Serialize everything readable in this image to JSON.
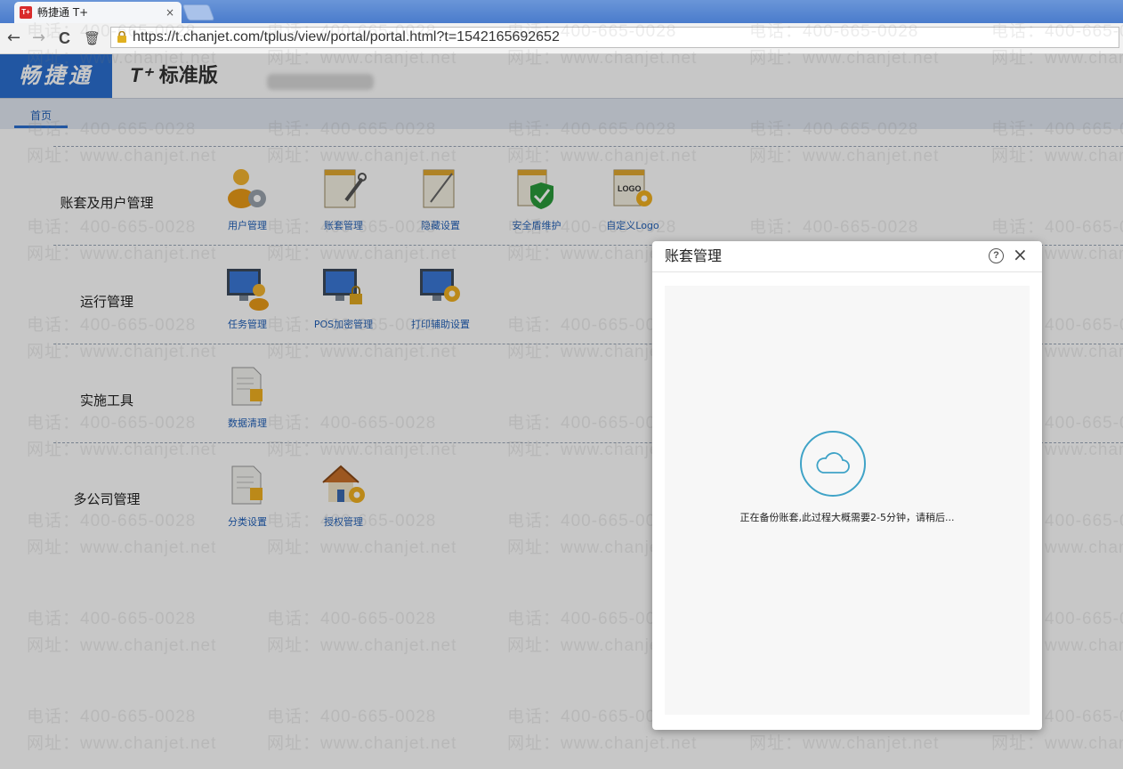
{
  "browser": {
    "tab_title": "畅捷通 T+",
    "tab_close": "×",
    "favicon_text": "T+",
    "back": "←",
    "forward": "→",
    "reload": "C",
    "delete": "🗑",
    "url": "https://t.chanjet.com/tplus/view/portal/portal.html?t=1542165692652"
  },
  "header": {
    "brand": "畅捷通",
    "product_t": "T⁺",
    "product_name": "标准版"
  },
  "nav": {
    "home": "首页"
  },
  "groups": [
    {
      "title": "账套及用户管理",
      "items": [
        "用户管理",
        "账套管理",
        "隐藏设置",
        "安全盾维护",
        "自定义Logo"
      ]
    },
    {
      "title": "运行管理",
      "items": [
        "任务管理",
        "POS加密管理",
        "打印辅助设置"
      ]
    },
    {
      "title": "实施工具",
      "items": [
        "数据清理"
      ]
    },
    {
      "title": "多公司管理",
      "items": [
        "分类设置",
        "授权管理"
      ]
    }
  ],
  "watermark": {
    "phone": "电话：400-665-0028",
    "site": "网址：www.chanjet.net"
  },
  "modal": {
    "title": "账套管理",
    "help": "?",
    "close": "×",
    "status": "正在备份账套,此过程大概需要2-5分钟，请稍后..."
  },
  "colors": {
    "accent": "#2b6fd0",
    "link": "#1f5fb8",
    "spinner": "#3fa3c7"
  }
}
